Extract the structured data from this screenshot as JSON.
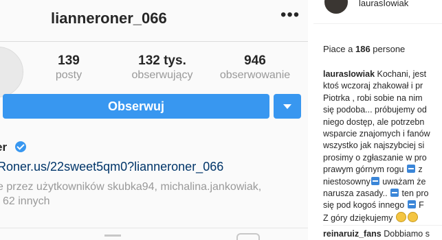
{
  "profile": {
    "username": "lianneroner_066",
    "more_icon": "more-horizontal-icon",
    "stats": [
      {
        "value": "139",
        "label": "posty"
      },
      {
        "value": "132 tys.",
        "label": "obserwujący"
      },
      {
        "value": "946",
        "label": "obserwowanie"
      }
    ],
    "follow_label": "Obserwuj",
    "name_fragment": "er",
    "link": "Roner.us/22sweet5qm0?lianneroner_066",
    "followed_by_line1": "e przez użytkowników skubka94, michalina.jankowiak,",
    "followed_by_line2": "i 62 innych"
  },
  "post": {
    "username": "laurasIowiak",
    "likes_prefix": "Piace a ",
    "likes_count": "186",
    "likes_suffix": " persone",
    "caption_user": "laurasIowiak",
    "caption_lines": [
      " Kochani, jest",
      "ktoś wczoraj zhakował i pr",
      "Piotrka , robi sobie na nim",
      "się podoba... próbujemy od",
      "niego dostęp, ale potrzebn",
      "wsparcie znajomych i fanów",
      "wszystko jak najszybciej si",
      "prosimy o zgłaszanie w pro",
      "prawym górnym rogu",
      " z",
      "niestosowny",
      " uważam że",
      "narusza zasady..",
      " ten pro",
      "się pod kogoś innego",
      " F",
      "Z góry dziękujemy"
    ],
    "comment_user": "reinaruiz_fans",
    "comment_text": " Dobbiamo s"
  },
  "colors": {
    "accent": "#3897f0",
    "link": "#003569",
    "muted": "#999999"
  }
}
